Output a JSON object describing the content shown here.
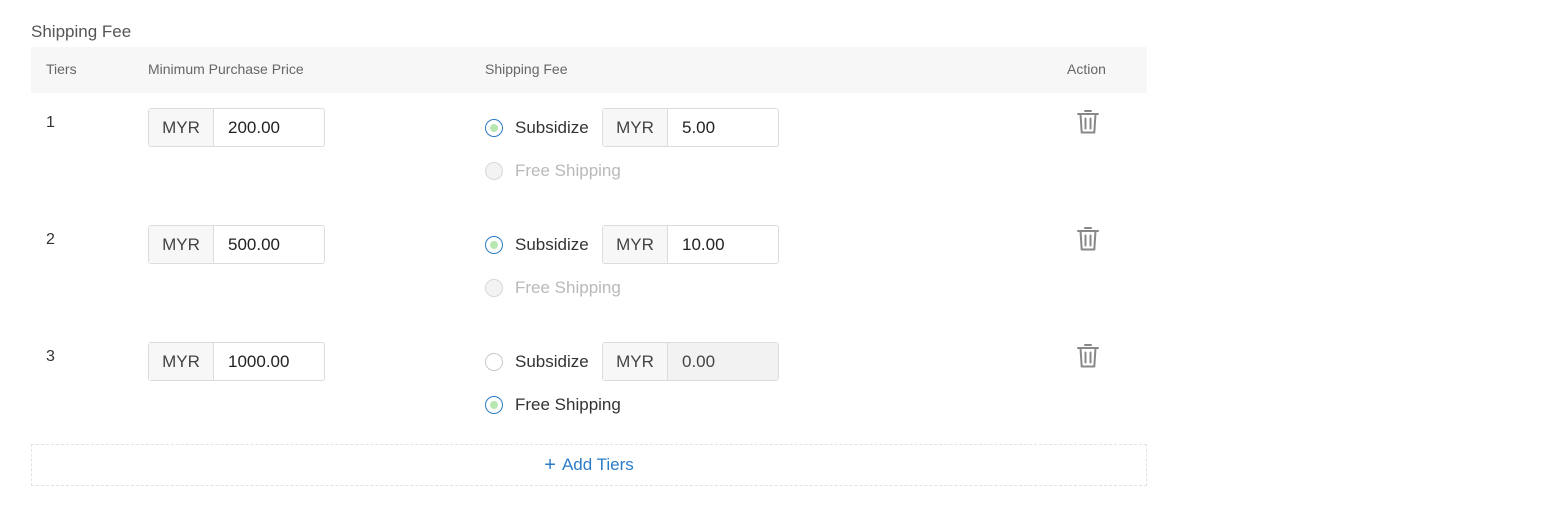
{
  "section_title": "Shipping Fee",
  "columns": {
    "tiers": "Tiers",
    "min_price": "Minimum Purchase Price",
    "shipping_fee": "Shipping Fee",
    "action": "Action"
  },
  "tiers": [
    {
      "number": "1",
      "currency": "MYR",
      "min_price": "200.00",
      "fee_currency": "MYR",
      "fee_value": "5.00",
      "subsidize_label": "Subsidize",
      "free_label": "Free Shipping",
      "selected": "subsidize"
    },
    {
      "number": "2",
      "currency": "MYR",
      "min_price": "500.00",
      "fee_currency": "MYR",
      "fee_value": "10.00",
      "subsidize_label": "Subsidize",
      "free_label": "Free Shipping",
      "selected": "subsidize"
    },
    {
      "number": "3",
      "currency": "MYR",
      "min_price": "1000.00",
      "fee_currency": "MYR",
      "fee_value": "0.00",
      "subsidize_label": "Subsidize",
      "free_label": "Free Shipping",
      "selected": "free"
    }
  ],
  "add_tiers_label": "Add Tiers",
  "icons": {
    "delete": "trash-icon",
    "add": "plus-icon"
  },
  "colors": {
    "accent": "#2b7cc7",
    "radio_fill": "#b8e6b0",
    "header_bg": "#f7f7f7"
  }
}
